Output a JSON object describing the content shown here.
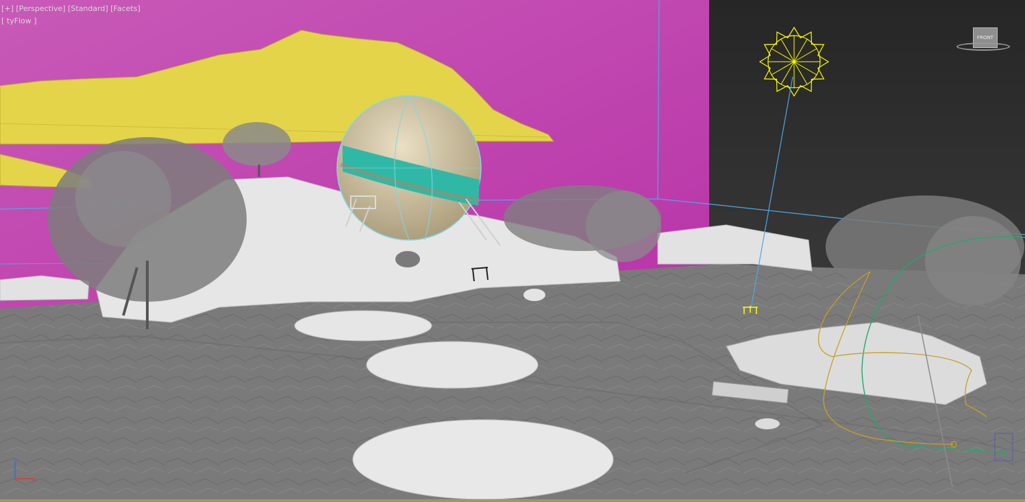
{
  "viewport": {
    "labels": {
      "plus": "[+]",
      "view": "[Perspective]",
      "shading": "[Standard]",
      "style": "[Facets]",
      "layer": "[ tyFlow ]"
    },
    "viewcube": {
      "face_label": "FRONT"
    },
    "axis": {
      "x": "x",
      "z": "z"
    }
  },
  "colors": {
    "backdrop_magenta": "#c54bb8",
    "backdrop_dark": "#2e2e2e",
    "ground": "#777777",
    "rocks": "#e8e8e8",
    "mountains": "#e6d84a",
    "sphere_body": "#cfc3a4",
    "sphere_band": "#2fb8a6",
    "sun_helper": "#ffff00",
    "wire_blue": "#4aa8e8",
    "spline_green": "#1faa6e",
    "spline_gold": "#c8a020"
  }
}
